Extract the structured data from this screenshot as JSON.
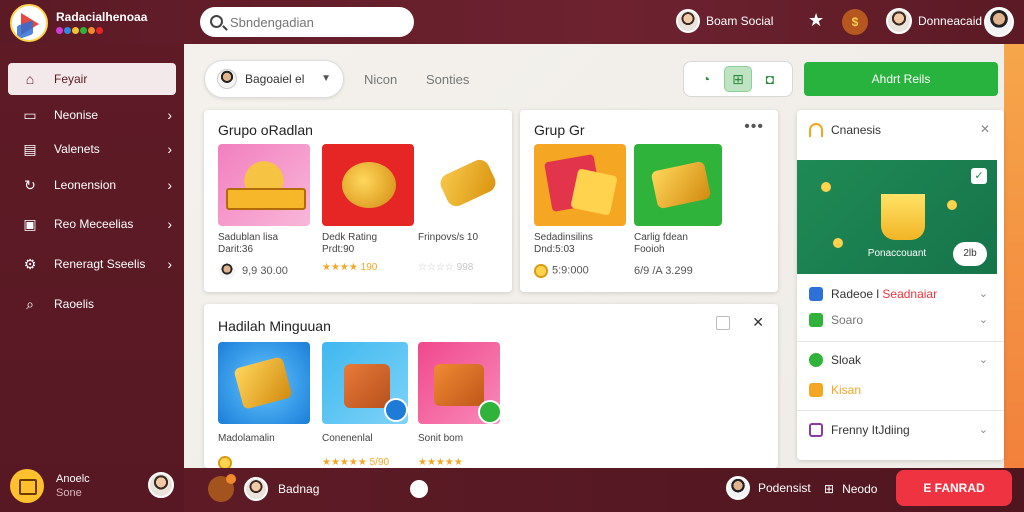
{
  "brand": {
    "title": "Radacialhenoaa"
  },
  "search": {
    "placeholder": "Sbndengadian"
  },
  "topbar": {
    "user1": "Boam Social",
    "user2": "Donneacaid"
  },
  "sidebar": {
    "items": [
      {
        "label": "Feyair",
        "icon": "home-icon",
        "chevron": false
      },
      {
        "label": "Neonise",
        "icon": "inbox-icon",
        "chevron": true
      },
      {
        "label": "Valenets",
        "icon": "card-icon",
        "chevron": true
      },
      {
        "label": "Leonension",
        "icon": "refresh-icon",
        "chevron": true
      },
      {
        "label": "Reo Meceelias",
        "icon": "chart-icon",
        "chevron": true
      },
      {
        "label": "Reneragt Sseelis",
        "icon": "gear-icon",
        "chevron": true
      },
      {
        "label": "Raoelis",
        "icon": "search-icon",
        "chevron": false
      }
    ],
    "bottom": {
      "title": "Anoelc",
      "sub": "Sone"
    }
  },
  "toolbar": {
    "filter_label": "Bagoaiel el",
    "tabs": [
      "Nicon",
      "Sonties"
    ],
    "cta_label": "Ahdrt Reils"
  },
  "card1": {
    "title": "Grupo oRadlan",
    "tiles": [
      {
        "name": "Sadublan lisa",
        "sub": "Darit:36",
        "price": "9,9 30.00"
      },
      {
        "name": "Dedk Rating",
        "sub": "Prdt:90",
        "rating": "★★★★ 190"
      },
      {
        "name": "Frinpovs/s 10",
        "rating": "☆☆☆☆ 998"
      }
    ]
  },
  "card2": {
    "title": "Grup Gr",
    "tiles": [
      {
        "name": "Sedadinsilins",
        "sub": "Dnd:5:03",
        "price": "5:9:000"
      },
      {
        "name": "Carlig fdean",
        "sub": "Fooioh",
        "price": "6/9 /A 3.299"
      }
    ]
  },
  "card3": {
    "title": "Hadilah Minguuan",
    "tiles": [
      {
        "name": "Madolamalin",
        "rating": ""
      },
      {
        "name": "Conenenlal",
        "rating": "★★★★★ 5/90"
      },
      {
        "name": "Sonit bom",
        "rating": "★★★★★"
      }
    ]
  },
  "rpanel": {
    "title": "Cnanesis",
    "promo_label": "Ponaccouant",
    "promo_pill": "2lb",
    "rows": [
      {
        "label": "Radeoe l",
        "accent": "Seadnaiar",
        "icon_color": "#2e6fd8"
      },
      {
        "label": "Soaro",
        "accent": "",
        "icon_color": "#2fb33a"
      },
      {
        "label": "Sloak",
        "accent": "",
        "icon_color": "#2fb33a"
      },
      {
        "label": "Kisan",
        "accent": "",
        "icon_color": "#f5a623"
      },
      {
        "label": "Frenny ItJdiing",
        "accent": "",
        "icon_color": "#8b3aa3"
      }
    ]
  },
  "bottombar": {
    "user_label": "Badnag",
    "right_user": "Podensist",
    "right_label2": "Neodo",
    "cta_label": "E FANRAD"
  },
  "colors": {
    "brand": "#5a1a24",
    "green": "#27b33e",
    "red": "#ef3340",
    "gold": "#f5a623"
  }
}
